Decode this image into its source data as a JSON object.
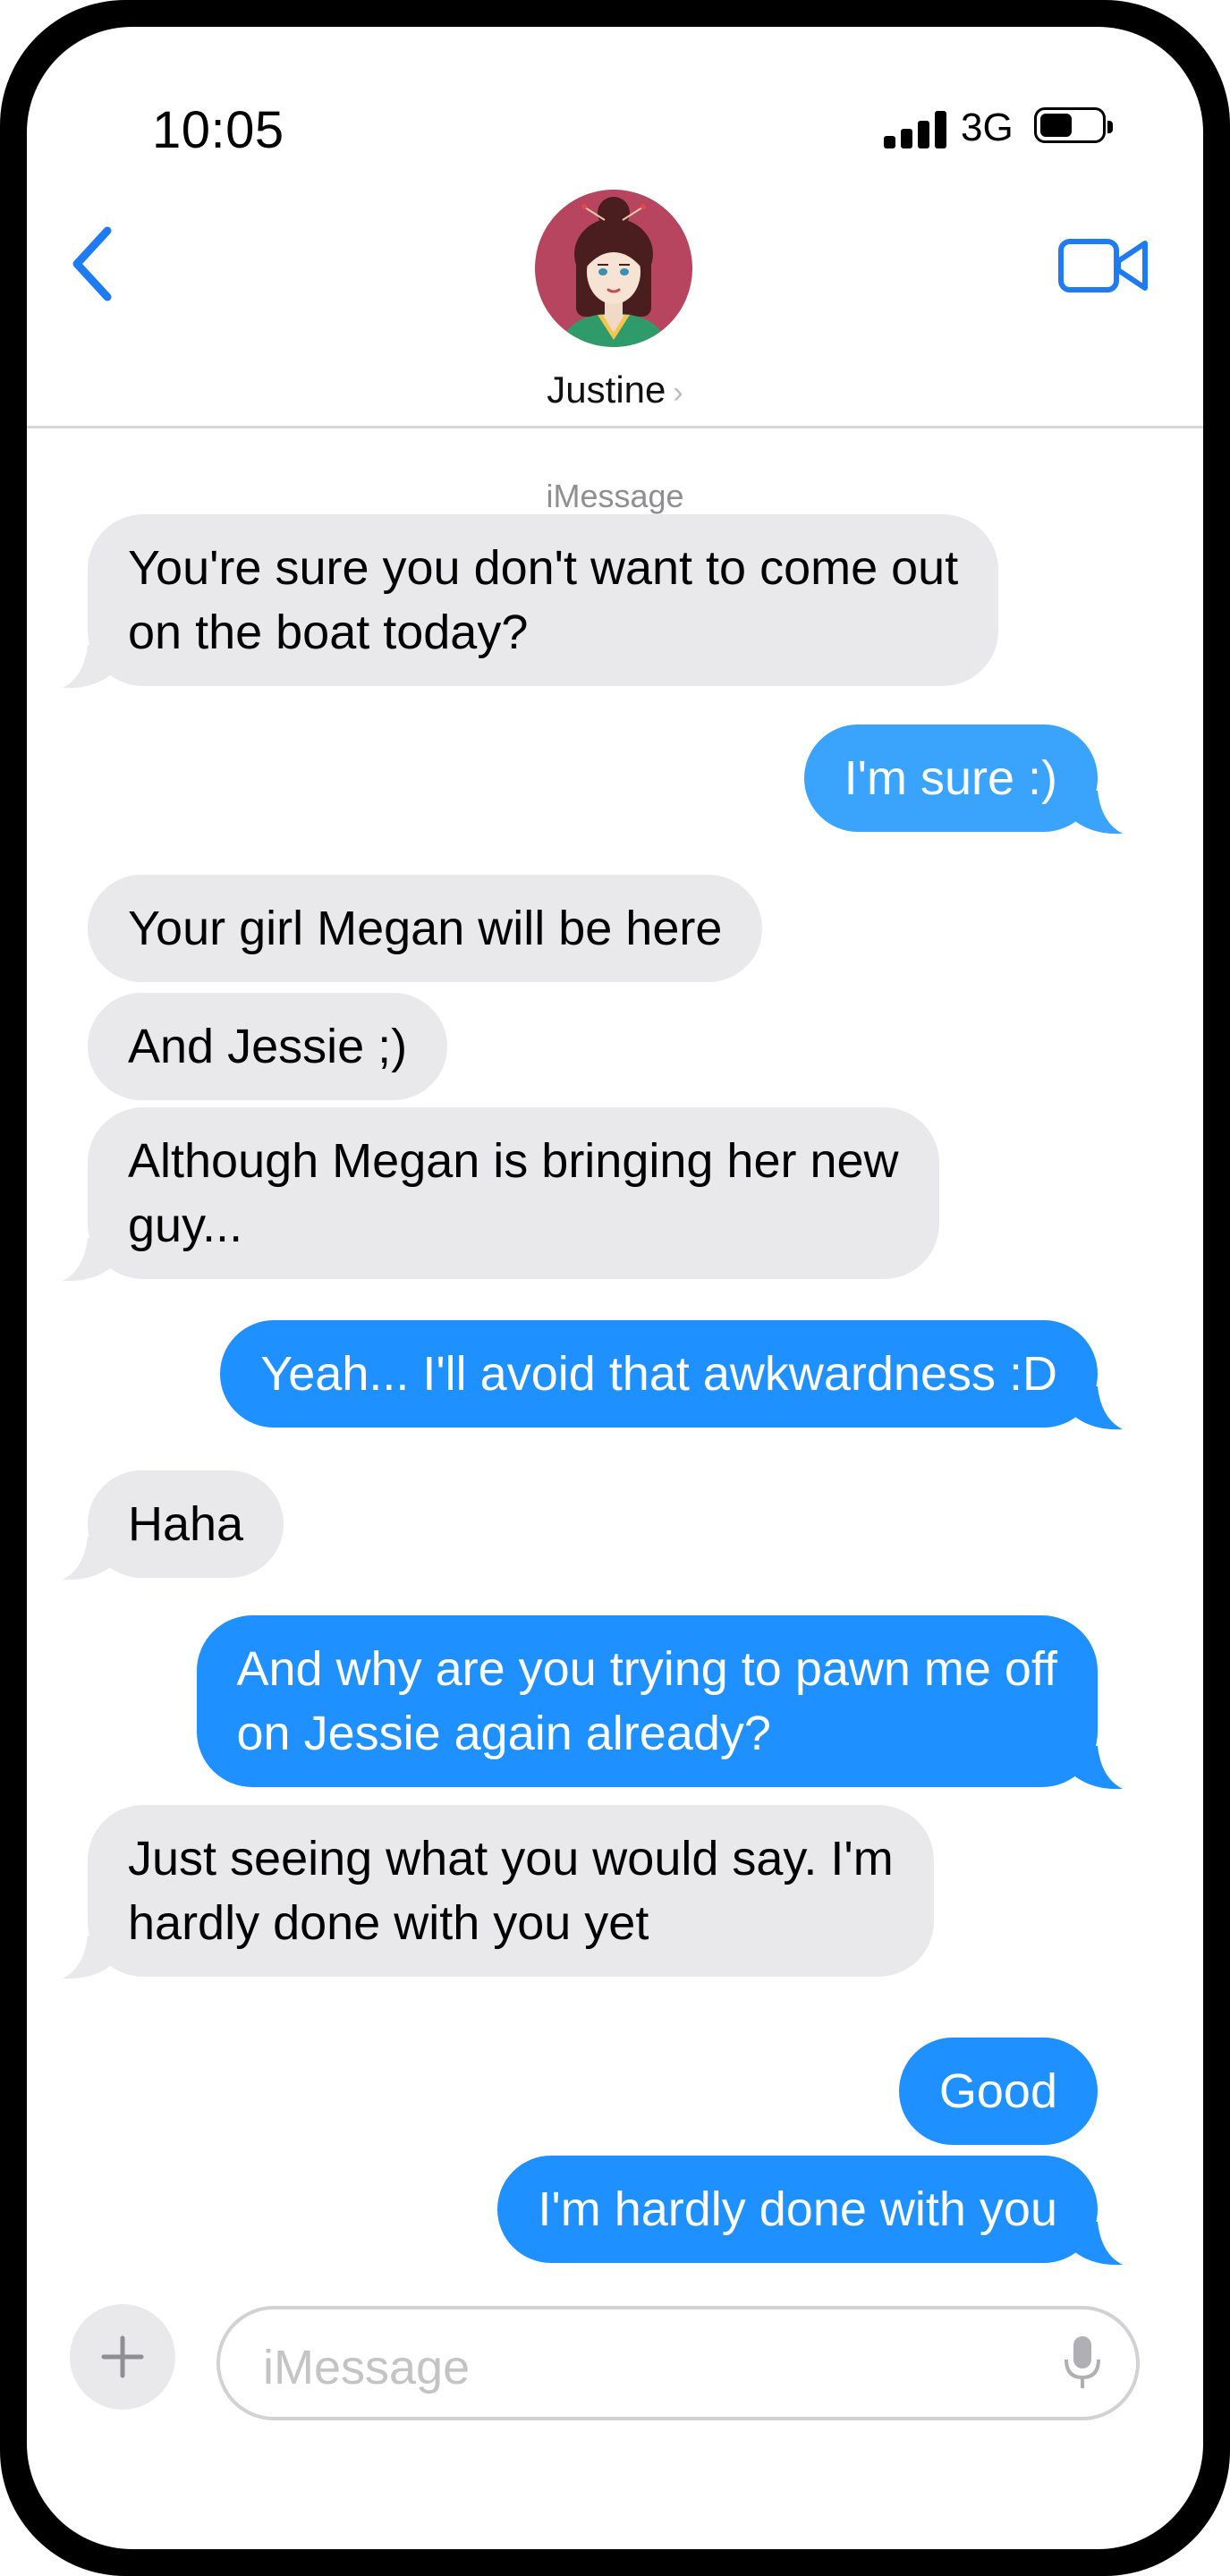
{
  "status_bar": {
    "time": "10:05",
    "network": "3G",
    "signal_bars": 4,
    "battery_level": 0.5
  },
  "header": {
    "contact_name": "Justine",
    "back_icon": "chevron-left-icon",
    "video_icon": "video-camera-icon",
    "accent_color": "#1e7bf2"
  },
  "thread": {
    "service_label": "iMessage",
    "messages": [
      {
        "direction": "incoming",
        "lines": [
          "You're sure you don't want to come out",
          "on the boat today?"
        ]
      },
      {
        "direction": "outgoing",
        "lines": [
          "I'm sure :)"
        ]
      },
      {
        "direction": "incoming",
        "lines": [
          "Your girl Megan will be here"
        ]
      },
      {
        "direction": "incoming",
        "lines": [
          "And Jessie ;)"
        ]
      },
      {
        "direction": "incoming",
        "lines": [
          "Although Megan is bringing her new",
          "guy..."
        ]
      },
      {
        "direction": "outgoing",
        "lines": [
          "Yeah... I'll avoid that awkwardness :D"
        ]
      },
      {
        "direction": "incoming",
        "lines": [
          "Haha"
        ]
      },
      {
        "direction": "outgoing",
        "lines": [
          "And why are you trying to pawn me off",
          "on Jessie again already?"
        ]
      },
      {
        "direction": "incoming",
        "lines": [
          "Just seeing what you would say.  I'm",
          "hardly done with you yet"
        ]
      },
      {
        "direction": "outgoing",
        "lines": [
          "Good"
        ]
      },
      {
        "direction": "outgoing",
        "lines": [
          "I'm hardly done with you"
        ]
      }
    ]
  },
  "composer": {
    "placeholder": "iMessage",
    "add_icon": "plus-icon",
    "mic_icon": "microphone-icon"
  },
  "colors": {
    "incoming_bubble": "#e9e9eb",
    "outgoing_bubble": "#1e90ff",
    "outgoing_bubble_early": "#3aa3fb"
  }
}
